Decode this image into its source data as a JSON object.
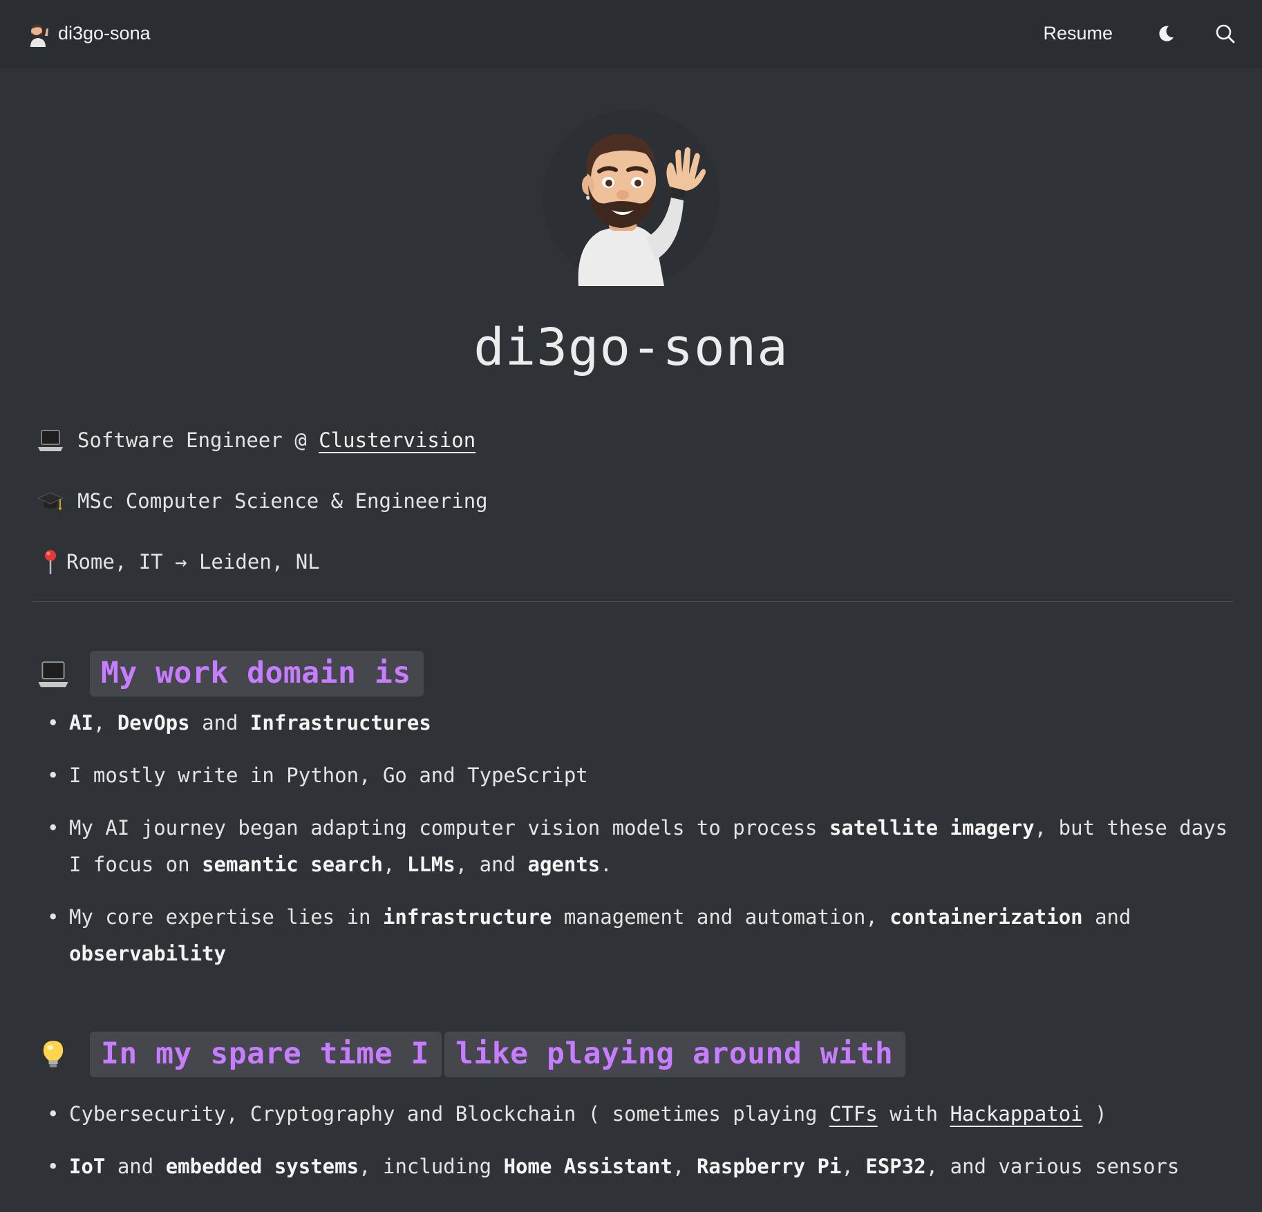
{
  "header": {
    "brand": "di3go-sona",
    "nav_resume": "Resume",
    "theme_toggle_icon": "moon-icon",
    "search_icon": "search-icon"
  },
  "hero": {
    "title": "di3go-sona",
    "avatar_icon": "memoji-waving-avatar"
  },
  "intro": {
    "work": {
      "icon": "laptop-icon",
      "prefix": "Software Engineer @ ",
      "link": "Clustervision"
    },
    "education": {
      "icon": "graduation-cap-icon",
      "text": "MSc Computer Science & Engineering"
    },
    "location": {
      "icon": "pin-icon",
      "text": "Rome, IT → Leiden, NL"
    }
  },
  "work_section": {
    "icon": "laptop-icon",
    "heading": "My work domain is",
    "bullets": [
      {
        "parts": [
          {
            "t": "AI",
            "b": true
          },
          {
            "t": ", "
          },
          {
            "t": "DevOps",
            "b": true
          },
          {
            "t": " and "
          },
          {
            "t": "Infrastructures",
            "b": true
          }
        ]
      },
      {
        "parts": [
          {
            "t": "I mostly write in Python, Go and TypeScript"
          }
        ]
      },
      {
        "parts": [
          {
            "t": "My AI journey began adapting computer vision models to process "
          },
          {
            "t": "satellite imagery",
            "b": true
          },
          {
            "t": ", but these days I focus on "
          },
          {
            "t": "semantic search",
            "b": true
          },
          {
            "t": ", "
          },
          {
            "t": "LLMs",
            "b": true
          },
          {
            "t": ", and "
          },
          {
            "t": "agents",
            "b": true
          },
          {
            "t": "."
          }
        ]
      },
      {
        "parts": [
          {
            "t": "My core expertise lies in "
          },
          {
            "t": "infrastructure",
            "b": true
          },
          {
            "t": " management and automation, "
          },
          {
            "t": "containerization",
            "b": true
          },
          {
            "t": " and "
          },
          {
            "t": "observability",
            "b": true
          }
        ]
      }
    ]
  },
  "spare_section": {
    "icon": "light-bulb-icon",
    "heading_part1": "In my spare time I",
    "heading_part2": "like playing around with",
    "bullets": [
      {
        "parts": [
          {
            "t": "Cybersecurity, Cryptography and Blockchain ( sometimes playing "
          },
          {
            "t": "CTFs",
            "link": true
          },
          {
            "t": " with "
          },
          {
            "t": "Hackappatoi",
            "link": true
          },
          {
            "t": " )"
          }
        ]
      },
      {
        "parts": [
          {
            "t": "IoT",
            "b": true
          },
          {
            "t": " and "
          },
          {
            "t": "embedded systems",
            "b": true
          },
          {
            "t": ", including "
          },
          {
            "t": "Home Assistant",
            "b": true
          },
          {
            "t": ", "
          },
          {
            "t": "Raspberry Pi",
            "b": true
          },
          {
            "t": ", "
          },
          {
            "t": "ESP32",
            "b": true
          },
          {
            "t": ", and various sensors"
          }
        ]
      }
    ]
  },
  "colors": {
    "background": "#2f3236",
    "topbar": "#2a2e33",
    "heading_accent": "#c77dff",
    "chip_background": "#45474d"
  }
}
